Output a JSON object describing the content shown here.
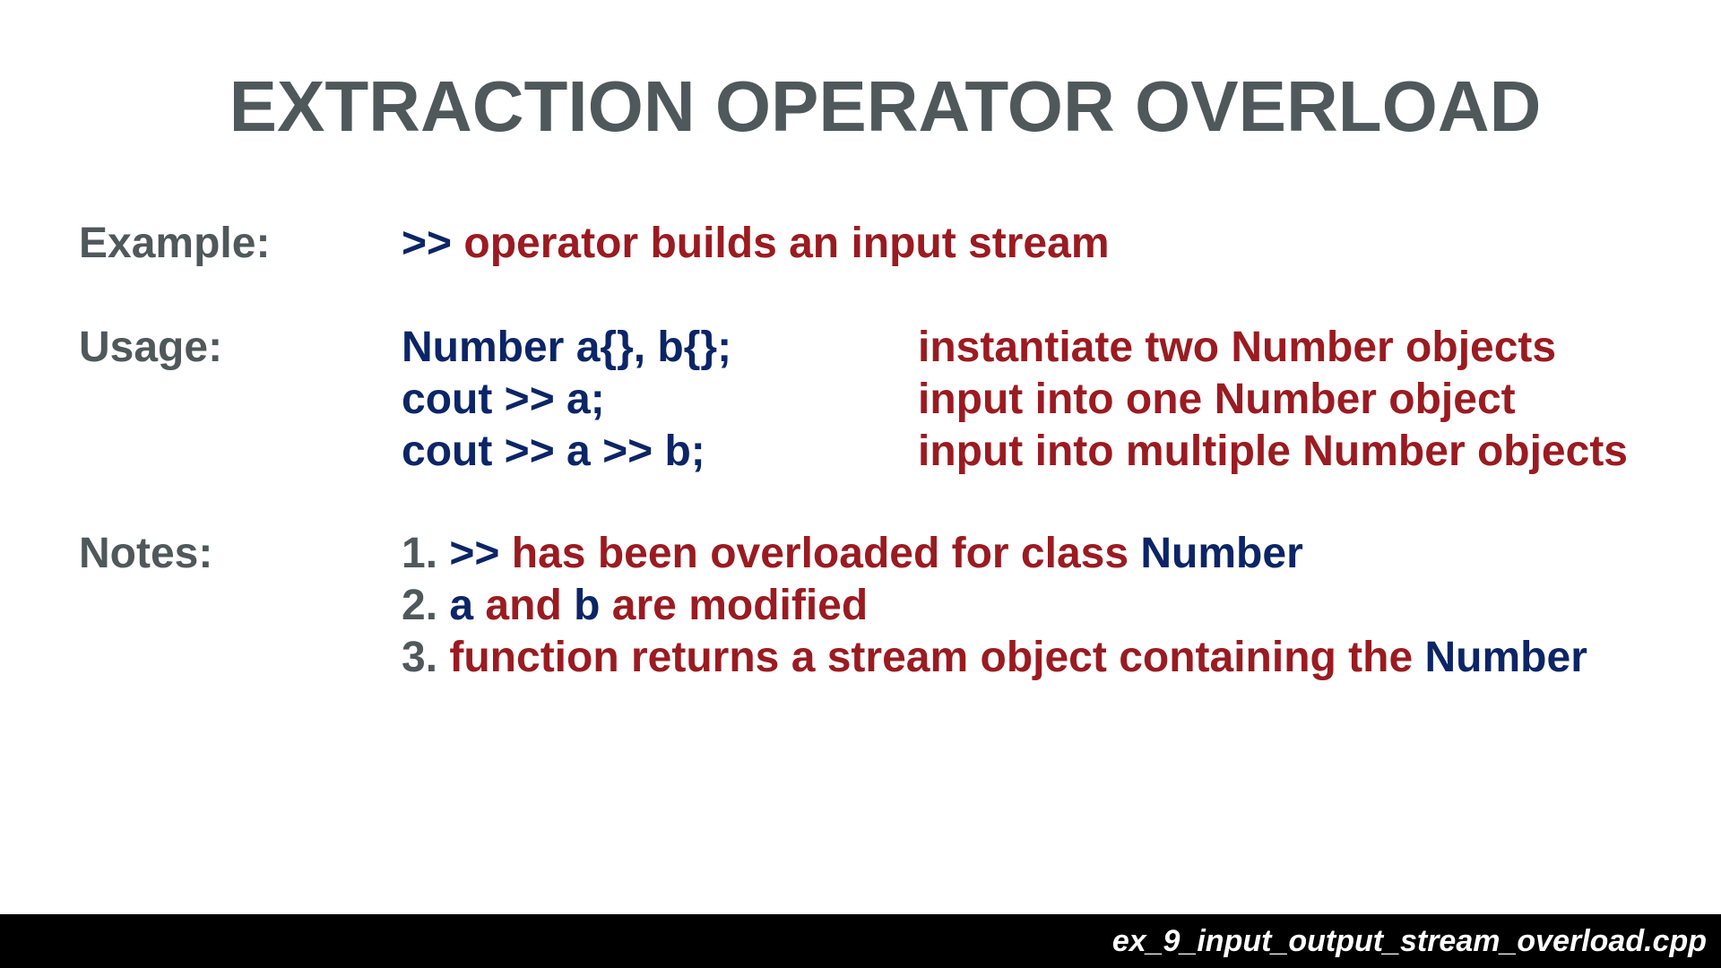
{
  "title": "EXTRACTION OPERATOR OVERLOAD",
  "example": {
    "label": "Example:",
    "operator": ">>",
    "text": "operator builds an input stream"
  },
  "usage": {
    "label": "Usage:",
    "rows": [
      {
        "code": "Number a{}, b{};",
        "comment": "instantiate two Number objects"
      },
      {
        "code": "cout >> a;",
        "comment": "input into one Number object"
      },
      {
        "code": "cout >> a >> b;",
        "comment": "input into multiple Number objects"
      }
    ]
  },
  "notes": {
    "label": "Notes:",
    "items": [
      {
        "number": "1.",
        "segments": [
          {
            "text": ">>",
            "tone": "code"
          },
          {
            "text": "has been overloaded for class",
            "tone": "text"
          },
          {
            "text": "Number",
            "tone": "code"
          }
        ]
      },
      {
        "number": "2.",
        "segments": [
          {
            "text": "a",
            "tone": "code"
          },
          {
            "text": "and",
            "tone": "text"
          },
          {
            "text": "b",
            "tone": "code"
          },
          {
            "text": "are modified",
            "tone": "text"
          }
        ]
      },
      {
        "number": "3.",
        "segments": [
          {
            "text": "function returns a stream object containing the",
            "tone": "text"
          },
          {
            "text": "Number",
            "tone": "code"
          }
        ]
      }
    ]
  },
  "footer": {
    "filename": "ex_9_input_output_stream_overload.cpp"
  },
  "colors": {
    "heading": "#4f585b",
    "code": "#0c2566",
    "text": "#9a1b21",
    "footer_bar": "#000000",
    "footer_text": "#ffffff"
  }
}
